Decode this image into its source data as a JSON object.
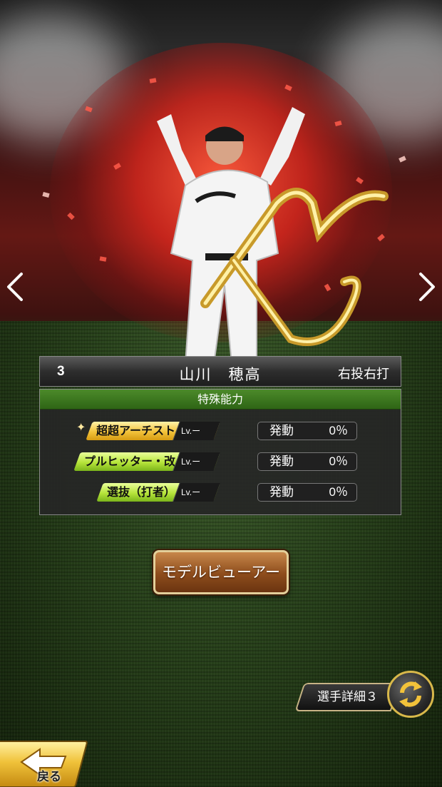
{
  "player": {
    "number": "3",
    "name": "山川　穂高",
    "handedness": "右投右打"
  },
  "abilities": {
    "header": "特殊能力",
    "items": [
      {
        "prefix": "超",
        "label": "超アーチスト",
        "level": "Lv.ー",
        "status_label": "発動",
        "percent": "0％",
        "tier": "gold"
      },
      {
        "prefix": "",
        "label": "プルヒッター・改",
        "level": "Lv.ー",
        "status_label": "発動",
        "percent": "0％",
        "tier": "green"
      },
      {
        "prefix": "",
        "label": "選抜（打者）",
        "level": "Lv.ー",
        "status_label": "発動",
        "percent": "0％",
        "tier": "green"
      }
    ]
  },
  "buttons": {
    "model_viewer": "モデルビューアー",
    "player_detail": "選手詳細３",
    "back": "戻る"
  },
  "icons": {
    "prev": "chevron-left-icon",
    "next": "chevron-right-icon",
    "refresh": "refresh-icon",
    "back_arrow": "back-arrow-icon"
  },
  "colors": {
    "ability_header": "#3a7a1f",
    "gold_tag": "#f2c23a",
    "green_tag": "#b6e43a",
    "button_brown": "#8d4c1c"
  }
}
